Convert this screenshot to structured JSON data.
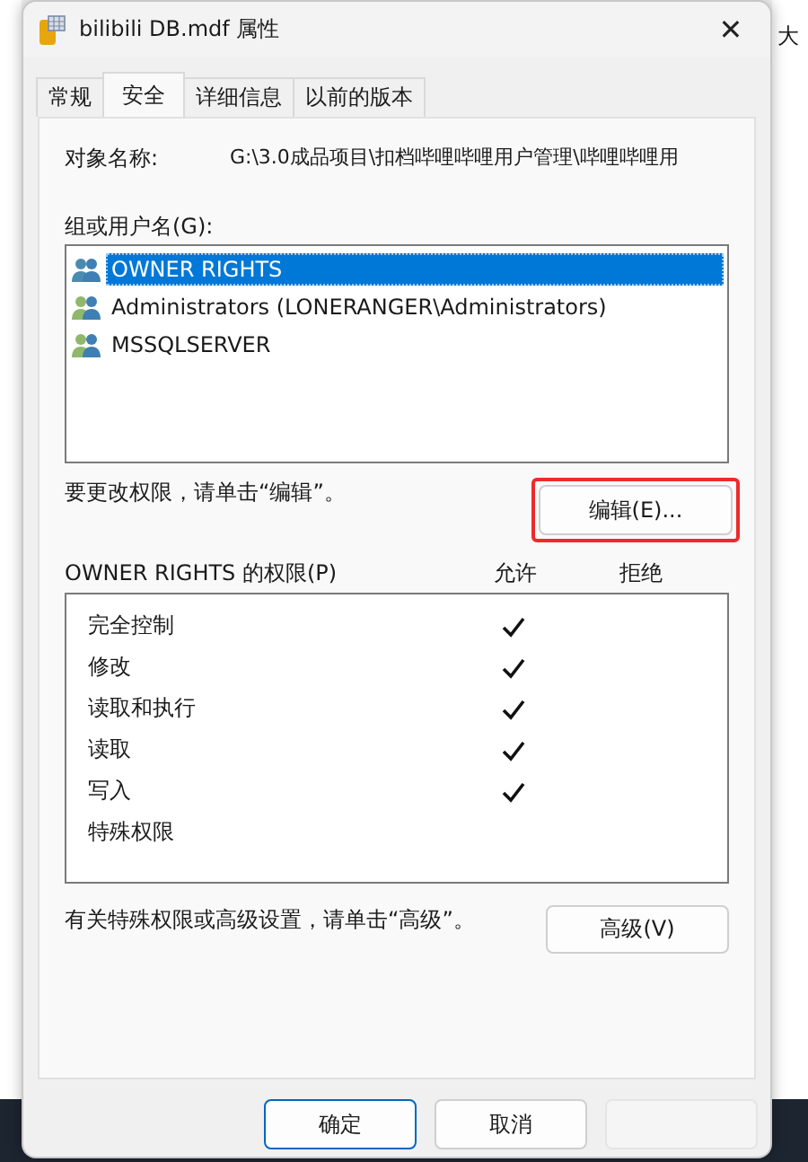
{
  "background": {
    "right_texts": [
      "大"
    ]
  },
  "window": {
    "title": "bilibili DB.mdf 属性",
    "close": "✕"
  },
  "tabs": [
    {
      "label": "常规",
      "selected": false
    },
    {
      "label": "安全",
      "selected": true
    },
    {
      "label": "详细信息",
      "selected": false
    },
    {
      "label": "以前的版本",
      "selected": false
    }
  ],
  "object_name": {
    "label": "对象名称:",
    "value": "G:\\3.0成品项目\\扣档哔哩哔哩用户管理\\哔哩哔哩用"
  },
  "groups": {
    "label": "组或用户名(G):",
    "items": [
      {
        "name": "OWNER RIGHTS",
        "selected": true
      },
      {
        "name": "Administrators (LONERANGER\\Administrators)",
        "selected": false
      },
      {
        "name": "MSSQLSERVER",
        "selected": false
      }
    ]
  },
  "edit_hint": "要更改权限，请单击“编辑”。",
  "edit_button": {
    "label": "编辑(E)...",
    "highlighted": true
  },
  "permissions": {
    "label": "OWNER RIGHTS 的权限(P)",
    "allow_header": "允许",
    "deny_header": "拒绝",
    "rows": [
      {
        "name": "完全控制",
        "allow": true,
        "deny": false
      },
      {
        "name": "修改",
        "allow": true,
        "deny": false
      },
      {
        "name": "读取和执行",
        "allow": true,
        "deny": false
      },
      {
        "name": "读取",
        "allow": true,
        "deny": false
      },
      {
        "name": "写入",
        "allow": true,
        "deny": false
      },
      {
        "name": "特殊权限",
        "allow": false,
        "deny": false
      }
    ]
  },
  "advanced_hint": "有关特殊权限或高级设置，请单击“高级”。",
  "advanced_button": {
    "label": "高级(V)"
  },
  "buttons": [
    {
      "label": "确定",
      "default": true,
      "disabled": false
    },
    {
      "label": "取消",
      "default": false,
      "disabled": false
    },
    {
      "default": false,
      "disabled": true
    }
  ]
}
